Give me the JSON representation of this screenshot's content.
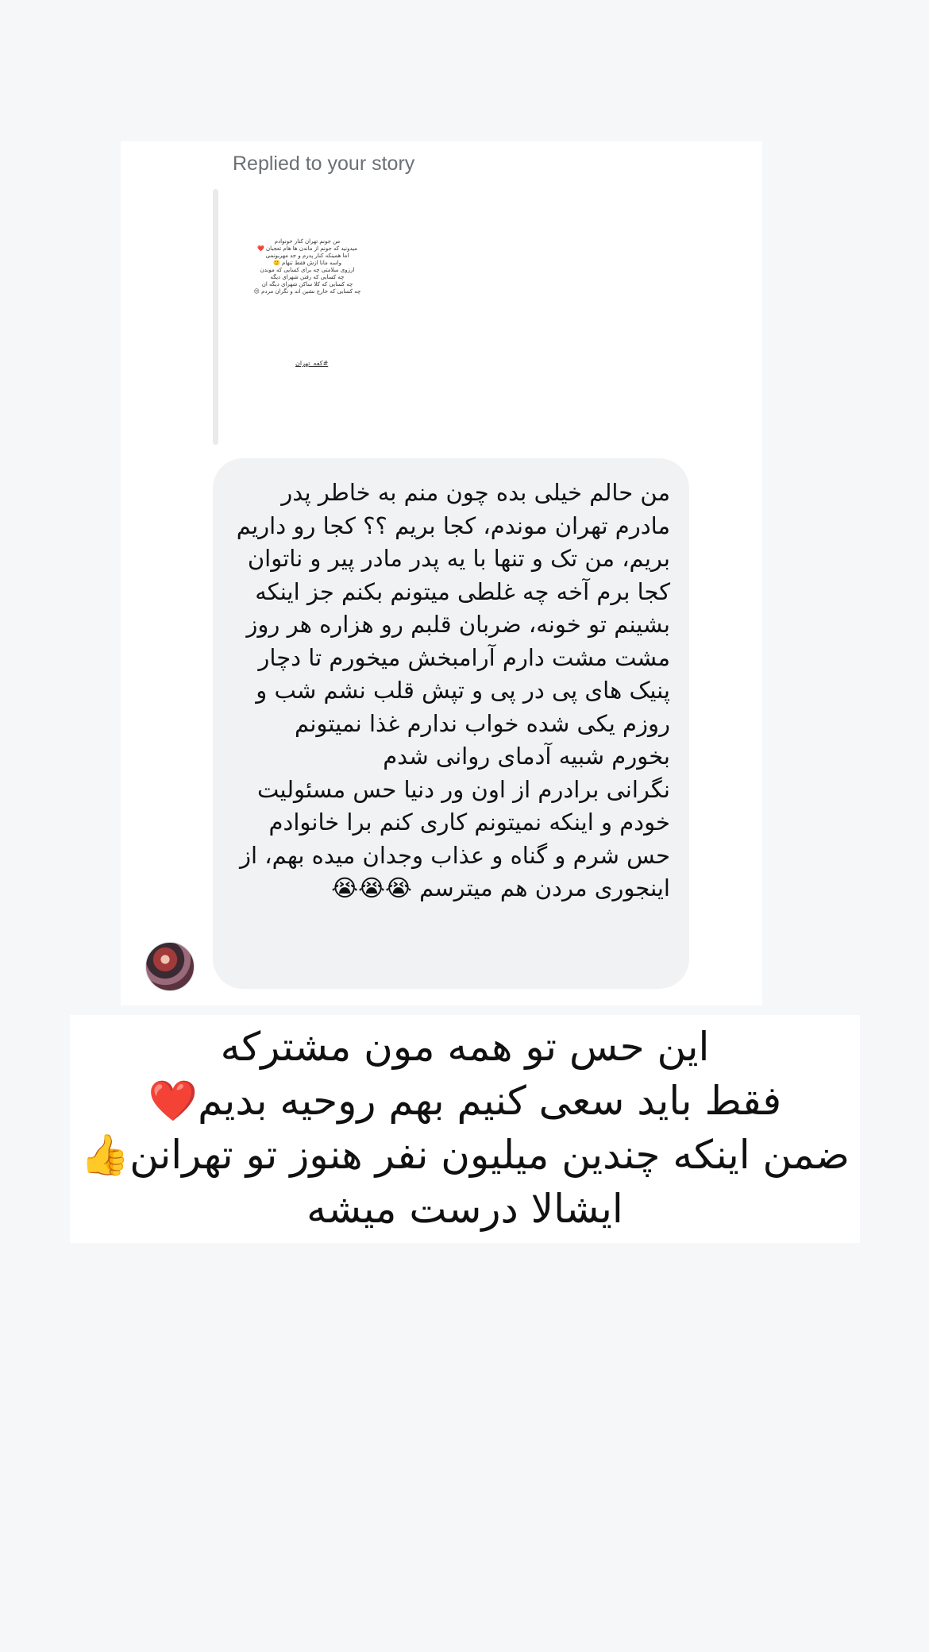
{
  "reply_context": {
    "label": "Replied to your story"
  },
  "story_preview": {
    "text_lines": "من جونم تهران کنار خونوادم\nمیدونید که جونم از ماندن ها هام تعجبان ❤️\nاما همینکه کنار پدرم و جد مهربونمی\nواسه مانا ازش فقط تنهام 🙂\nارزوی سلامتی چه برای کسایی که موندن\nچه کسایی که رفتن شهرای دیگه\nچه کسایی که کلا ساکن شهرای دیگه ان\nچه کسایی که خارج نشین اند و نگران مردم 😔",
    "hashtag": "#کفه_تهران"
  },
  "message": {
    "text": "من حالم خیلی بده چون منم به خاطر پدر مادرم تهران موندم، کجا بریم ؟؟ کجا رو داریم بریم، من تک و تنها با یه پدر مادر پیر و ناتوان کجا برم آخه چه غلطی میتونم بکنم جز اینکه بشینم تو خونه، ضربان قلبم رو هزاره هر روز مشت مشت دارم آرامبخش میخورم تا دچار پنیک های پی در پی و تپش قلب نشم شب و روزم یکی شده خواب ندارم غذا نمیتونم بخورم شبیه آدمای روانی شدم\nنگرانی برادرم از اون ور دنیا حس مسئولیت خودم و اینکه نمیتونم کاری کنم برا خانوادم حس شرم و گناه و عذاب وجدان میده بهم، از اینجوری مردن هم میترسم  😭😭😭"
  },
  "caption": {
    "text": "این حس تو همه مون مشترکه\nفقط باید سعی کنیم بهم روحیه بدیم❤️\nضمن اینکه چندین میلیون نفر هنوز تو تهرانن👍\nایشالا درست میشه"
  },
  "colors": {
    "page_background": "#f6f7f9",
    "card_background": "#ffffff",
    "bubble_background": "#f1f2f4",
    "muted_text": "#6b6f76"
  }
}
